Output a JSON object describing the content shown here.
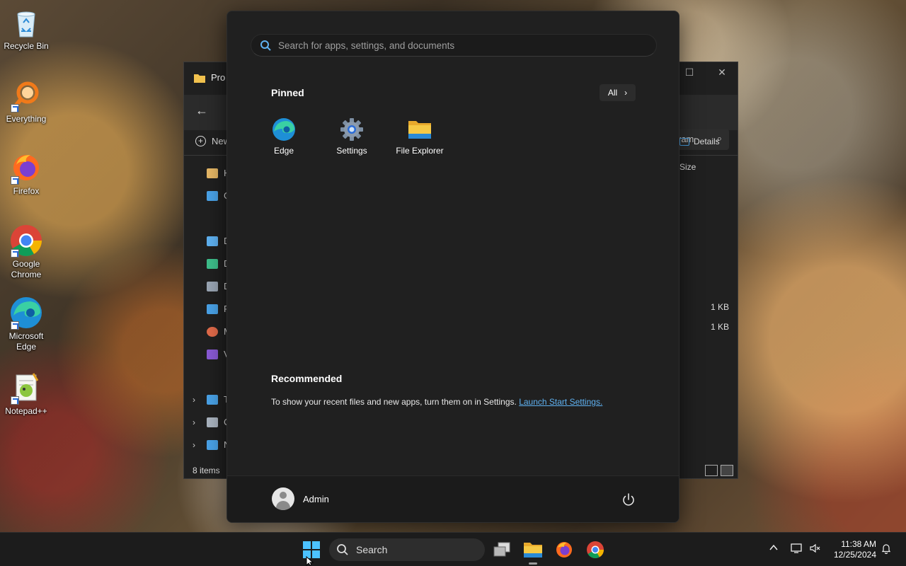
{
  "desktop": {
    "icons": [
      {
        "label": "Recycle Bin",
        "icon": "recycle-bin-icon"
      },
      {
        "label": "Everything",
        "icon": "everything-icon"
      },
      {
        "label": "Firefox",
        "icon": "firefox-icon"
      },
      {
        "label": "Google Chrome",
        "icon": "chrome-icon"
      },
      {
        "label": "Microsoft Edge",
        "icon": "edge-icon"
      },
      {
        "label": "Notepad++",
        "icon": "notepadpp-icon"
      }
    ]
  },
  "explorer": {
    "title_partial": "Pro",
    "new_button_partial": "New",
    "search_partial": "ram",
    "details_label": "Details",
    "size_header": "Size",
    "sizes": [
      "1 KB",
      "1 KB"
    ],
    "status": "8 items",
    "sidebar_initials": [
      "H",
      "G",
      "D",
      "D",
      "D",
      "P",
      "M",
      "V",
      "T",
      "C",
      "N"
    ]
  },
  "start_menu": {
    "search_placeholder": "Search for apps, settings, and documents",
    "pinned_title": "Pinned",
    "all_label": "All",
    "pinned": [
      {
        "label": "Edge",
        "icon": "edge-icon"
      },
      {
        "label": "Settings",
        "icon": "settings-gear-icon"
      },
      {
        "label": "File Explorer",
        "icon": "folder-icon"
      }
    ],
    "recommended_title": "Recommended",
    "recommended_text": "To show your recent files and new apps, turn them on in Settings.",
    "recommended_link": "Launch Start Settings.",
    "user_name": "Admin"
  },
  "taskbar": {
    "search_label": "Search",
    "time": "11:38 AM",
    "date": "12/25/2024"
  },
  "colors": {
    "accent": "#5fb2f2",
    "start_bg": "#202020",
    "taskbar_bg": "#1c1c1c"
  }
}
